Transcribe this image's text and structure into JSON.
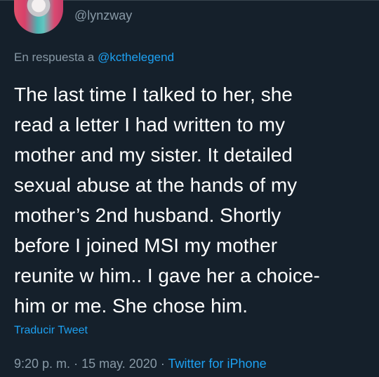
{
  "tweet": {
    "handle": "@lynzway",
    "reply_prefix": "En respuesta a ",
    "reply_to": "@kcthelegend",
    "body_lines": [
      "The last time I talked to her, she",
      "read a letter I had written to my",
      "mother and my sister. It detailed",
      "sexual abuse at the hands of my",
      "mother’s 2nd husband. Shortly",
      "before I joined MSI my mother",
      "reunite w him.. I gave her a choice-",
      "him or me. She chose him."
    ],
    "translate_label": "Traducir Tweet",
    "time": "9:20 p. m.",
    "separator": "·",
    "date": "15 may. 2020",
    "source": "Twitter for iPhone"
  },
  "colors": {
    "background": "#15202b",
    "text": "#ffffff",
    "secondary": "#8899a6",
    "accent": "#1da1f2"
  }
}
